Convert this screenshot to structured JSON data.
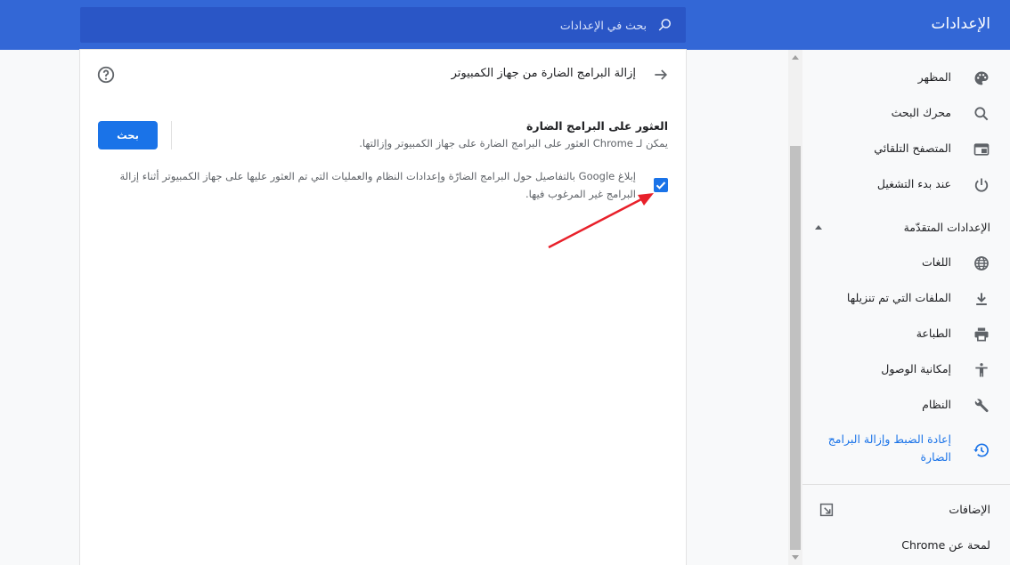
{
  "header": {
    "title": "الإعدادات",
    "search_placeholder": "بحث في الإعدادات"
  },
  "subpage": {
    "title": "إزالة البرامج الضارة من جهاز الكمبيوتر",
    "section_title": "العثور على البرامج الضارة",
    "section_description": "يمكن لـ Chrome العثور على البرامج الضارة على جهاز الكمبيوتر وإزالتها.",
    "find_button_label": "بحث",
    "report_checkbox_checked": true,
    "report_text": "إبلاغ Google بالتفاصيل حول البرامج الضارّة وإعدادات النظام والعمليات التي تم العثور عليها على جهاز الكمبيوتر أثناء إزالة البرامج غير المرغوب فيها."
  },
  "sidebar": {
    "items": [
      {
        "label": "المظهر",
        "icon": "palette-icon"
      },
      {
        "label": "محرك البحث",
        "icon": "search-icon"
      },
      {
        "label": "المتصفح التلقائي",
        "icon": "browser-icon"
      },
      {
        "label": "عند بدء التشغيل",
        "icon": "power-icon"
      }
    ],
    "advanced_label": "الإعدادات المتقدّمة",
    "advanced_items": [
      {
        "label": "اللغات",
        "icon": "globe-icon"
      },
      {
        "label": "الملفات التي تم تنزيلها",
        "icon": "download-icon"
      },
      {
        "label": "الطباعة",
        "icon": "print-icon"
      },
      {
        "label": "إمكانية الوصول",
        "icon": "accessibility-icon"
      },
      {
        "label": "النظام",
        "icon": "wrench-icon"
      },
      {
        "label": "إعادة الضبط وإزالة البرامج الضارة",
        "icon": "restore-icon",
        "active": true
      }
    ],
    "extensions_label": "الإضافات",
    "about_label": "لمحة عن Chrome"
  },
  "colors": {
    "header": "#3367d6",
    "accent": "#1a73e8",
    "annotation_arrow": "#e8202a"
  }
}
